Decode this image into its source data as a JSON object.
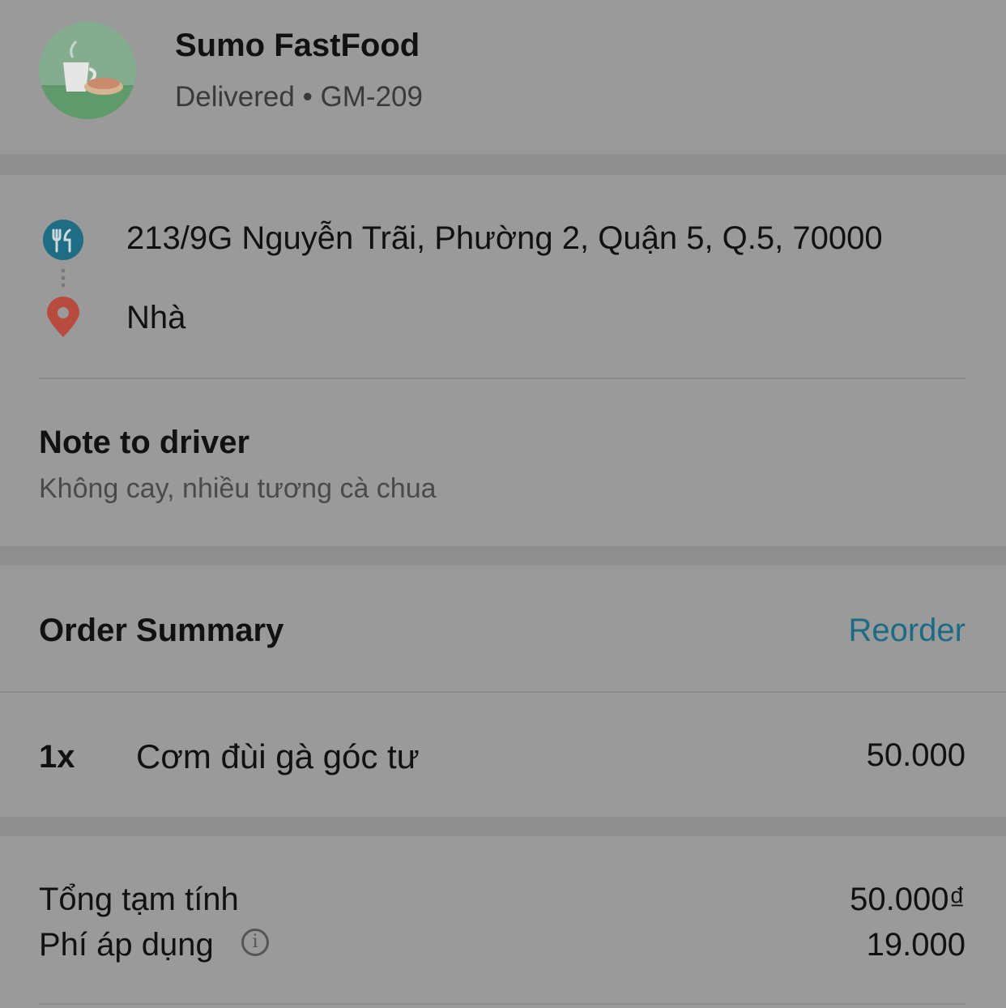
{
  "header": {
    "store_name": "Sumo FastFood",
    "order_status": "Delivered • GM-209",
    "logo_icon": "coffee-bread-logo"
  },
  "route": {
    "pickup_address": "213/9G Nguyễn Trãi, Phường 2, Quận 5, Q.5, 70000",
    "pickup_icon": "restaurant-icon",
    "dropoff_label": "Nhà",
    "dropoff_icon": "location-pin-icon"
  },
  "note": {
    "title": "Note to driver",
    "text": "Không cay, nhiều tương cà chua"
  },
  "order_summary": {
    "title": "Order Summary",
    "reorder_label": "Reorder",
    "items": [
      {
        "qty": "1x",
        "name": "Cơm đùi gà góc tư",
        "price": "50.000"
      }
    ]
  },
  "totals": {
    "subtotal_label": "Tổng tạm tính",
    "subtotal_value": "50.000₫",
    "fee_label": "Phí áp dụng",
    "fee_value": "19.000",
    "fee_info_icon": "info-icon"
  },
  "colors": {
    "accent": "#1b6b84",
    "pickup_icon": "#1e6d85",
    "dropoff_icon": "#b84a3e"
  }
}
